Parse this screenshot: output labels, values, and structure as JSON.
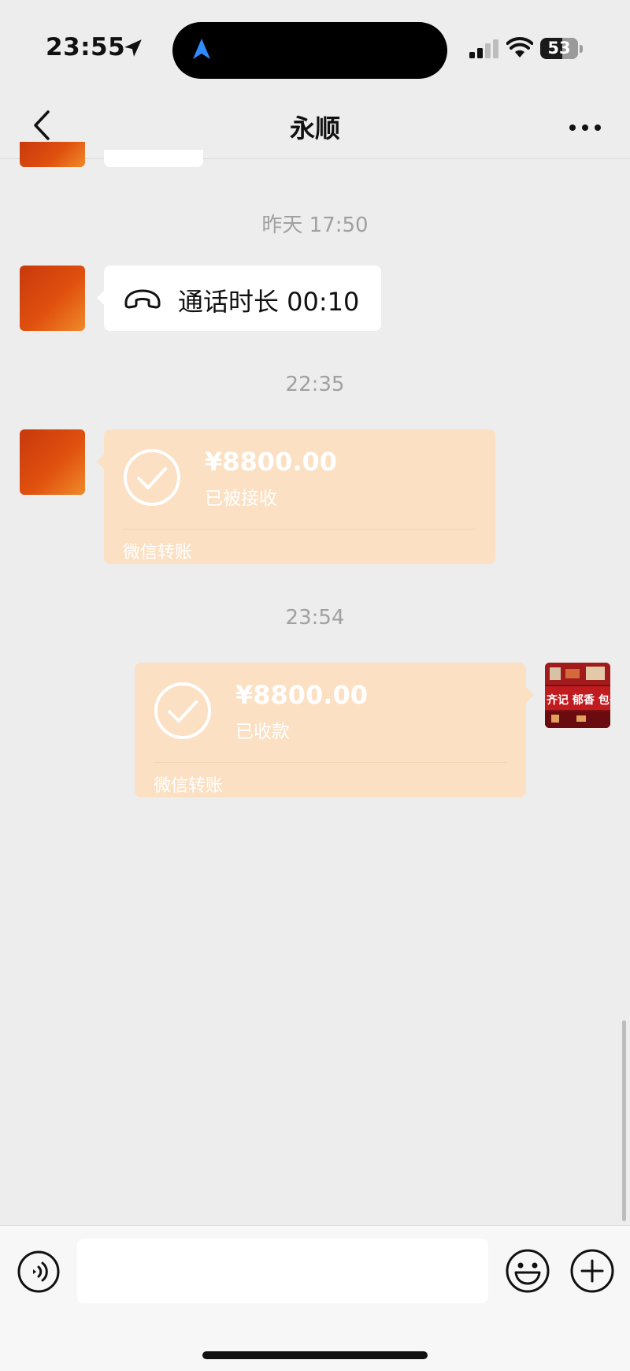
{
  "status_bar": {
    "time": "23:55",
    "battery": "53"
  },
  "header": {
    "title": "永顺"
  },
  "messages": {
    "ts1": "昨天 17:50",
    "call_text": "通话时长 00:10",
    "ts2": "22:35",
    "transfer1": {
      "amount": "¥8800.00",
      "status": "已被接收",
      "label": "微信转账"
    },
    "ts3": "23:54",
    "transfer2": {
      "amount": "¥8800.00",
      "status": "已收款",
      "label": "微信转账"
    },
    "store_sign": "齐记 郁香 包子"
  },
  "input": {
    "value": ""
  },
  "colors": {
    "transfer_bubble": "#fbe0c3",
    "background": "#ededed",
    "avatar_orange": "#e0500e"
  },
  "icons": [
    "location-arrow-icon",
    "navigation-icon",
    "signal-icon",
    "wifi-icon",
    "battery-icon",
    "back-icon",
    "more-icon",
    "phone-hangup-icon",
    "check-circle-icon",
    "voice-icon",
    "emoji-icon",
    "plus-icon"
  ]
}
